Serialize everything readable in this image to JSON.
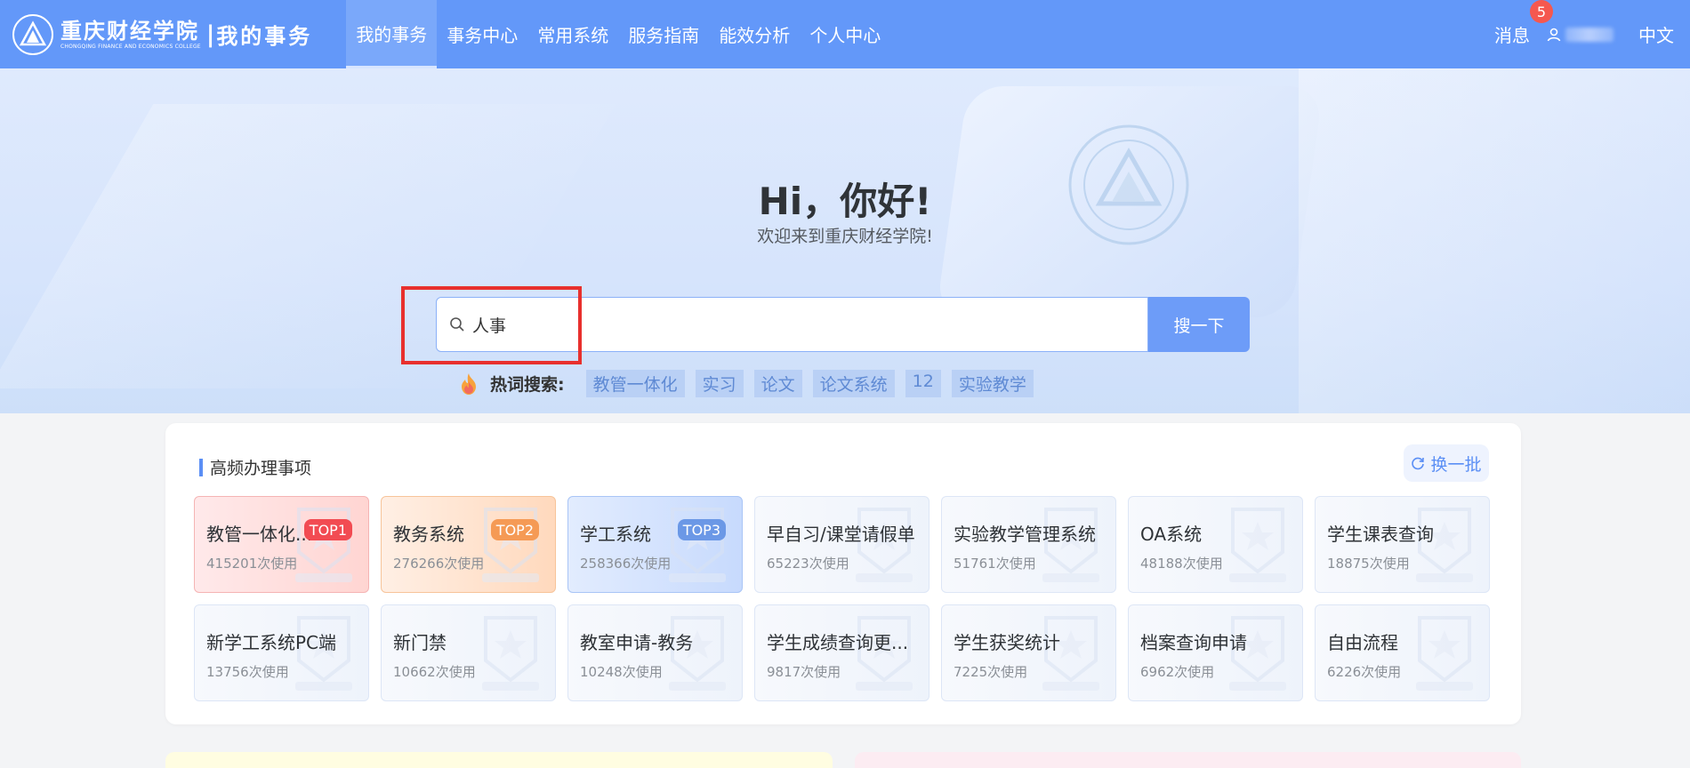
{
  "header": {
    "logo_cn": "重庆财经学院",
    "logo_en": "CHONGQING FINANCE AND ECONOMICS COLLEGE",
    "separator": "|",
    "section_title": "我的事务",
    "menu": [
      {
        "label": "我的事务",
        "active": true
      },
      {
        "label": "事务中心",
        "active": false
      },
      {
        "label": "常用系统",
        "active": false
      },
      {
        "label": "服务指南",
        "active": false
      },
      {
        "label": "能效分析",
        "active": false
      },
      {
        "label": "个人中心",
        "active": false
      }
    ],
    "messages_label": "消息",
    "messages_count": "5",
    "language": "中文"
  },
  "hero": {
    "title": "Hi，你好!",
    "subtitle": "欢迎来到重庆财经学院!",
    "search_value": "人事",
    "search_button": "搜一下",
    "hot_label": "热词搜索:",
    "hot_words": [
      "教管一体化",
      "实习",
      "论文",
      "论文系统",
      "12",
      "实验教学"
    ]
  },
  "frequent": {
    "title": "高频办理事项",
    "refresh_label": "换一批",
    "items": [
      {
        "name": "教管一体化...",
        "count": "415201次使用",
        "badge": "TOP1",
        "tier": "top1"
      },
      {
        "name": "教务系统",
        "count": "276266次使用",
        "badge": "TOP2",
        "tier": "top2"
      },
      {
        "name": "学工系统",
        "count": "258366次使用",
        "badge": "TOP3",
        "tier": "top3"
      },
      {
        "name": "早自习/课堂请假单",
        "count": "65223次使用",
        "badge": "",
        "tier": ""
      },
      {
        "name": "实验教学管理系统",
        "count": "51761次使用",
        "badge": "",
        "tier": ""
      },
      {
        "name": "OA系统",
        "count": "48188次使用",
        "badge": "",
        "tier": ""
      },
      {
        "name": "学生课表查询",
        "count": "18875次使用",
        "badge": "",
        "tier": ""
      },
      {
        "name": "新学工系统PC端",
        "count": "13756次使用",
        "badge": "",
        "tier": ""
      },
      {
        "name": "新门禁",
        "count": "10662次使用",
        "badge": "",
        "tier": ""
      },
      {
        "name": "教室申请-教务",
        "count": "10248次使用",
        "badge": "",
        "tier": ""
      },
      {
        "name": "学生成绩查询更...",
        "count": "9817次使用",
        "badge": "",
        "tier": ""
      },
      {
        "name": "学生获奖统计",
        "count": "7225次使用",
        "badge": "",
        "tier": ""
      },
      {
        "name": "档案查询申请",
        "count": "6962次使用",
        "badge": "",
        "tier": ""
      },
      {
        "name": "自由流程",
        "count": "6226次使用",
        "badge": "",
        "tier": ""
      }
    ]
  },
  "colors": {
    "nav": "#6398f9",
    "top1": "#f24b52",
    "top2": "#f59a55",
    "top3": "#6b98e6",
    "highlight": "#e8302d"
  }
}
